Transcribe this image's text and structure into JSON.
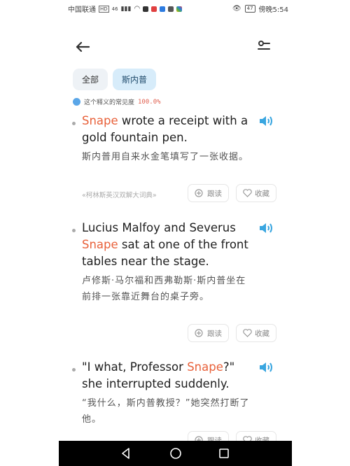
{
  "status": {
    "carrier": "中国联通",
    "badges": [
      "HD",
      "46"
    ],
    "battery": "47",
    "time": "傍晚5:54"
  },
  "header": {
    "back_icon": "back-arrow-icon",
    "filter_icon": "filter-icon"
  },
  "tabs": [
    {
      "label": "全部",
      "active": false
    },
    {
      "label": "斯内普",
      "active": true
    }
  ],
  "frequency": {
    "label": "这个释义的常见度",
    "value": "100.0%"
  },
  "entries": [
    {
      "keyword": "Snape",
      "en_after": " wrote a receipt with a gold fountain pen.",
      "zh": "斯内普用自来水金笔填写了一张收据。",
      "source": "«柯林斯英汉双解大词典»",
      "follow_label": "跟读",
      "collect_label": "收藏"
    },
    {
      "en_before": "Lucius Malfoy and Severus ",
      "keyword": "Snape",
      "en_after": " sat at one of the front tables near the stage.",
      "zh": "卢修斯·马尔福和西弗勒斯·斯内普坐在前排一张靠近舞台的桌子旁。",
      "follow_label": "跟读",
      "collect_label": "收藏"
    },
    {
      "en_before": "\"I what, Professor ",
      "keyword": "Snape",
      "en_after": "?\" she interrupted suddenly.",
      "zh": "“我什么，斯内普教授？”她突然打断了他。",
      "follow_label": "跟读",
      "collect_label": "收藏"
    }
  ],
  "colors": {
    "keyword": "#e8613a",
    "speaker": "#3aa6e0",
    "tab_active_bg": "#d7ecfa"
  }
}
